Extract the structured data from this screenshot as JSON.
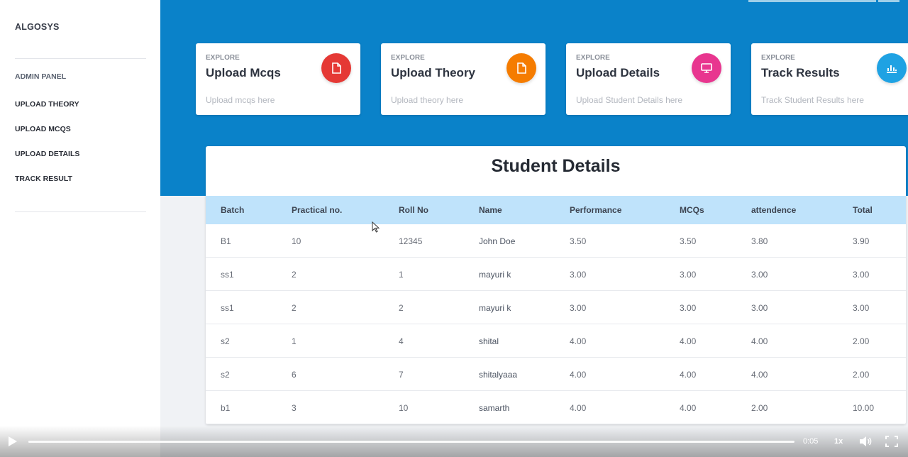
{
  "sidebar": {
    "brand": "ALGOSYS",
    "items": [
      {
        "label": "ADMIN PANEL"
      },
      {
        "label": "UPLOAD THEORY"
      },
      {
        "label": "UPLOAD MCQS"
      },
      {
        "label": "UPLOAD DETAILS"
      },
      {
        "label": "TRACK RESULT"
      }
    ]
  },
  "cards": [
    {
      "kicker": "EXPLORE",
      "title": "Upload Mcqs",
      "desc": "Upload mcqs here",
      "color": "#e53935",
      "icon": "document-icon"
    },
    {
      "kicker": "EXPLORE",
      "title": "Upload Theory",
      "desc": "Upload theory here",
      "color": "#f57c00",
      "icon": "document-icon"
    },
    {
      "kicker": "EXPLORE",
      "title": "Upload Details",
      "desc": "Upload Student Details here",
      "color": "#e8368f",
      "icon": "monitor-icon"
    },
    {
      "kicker": "EXPLORE",
      "title": "Track Results",
      "desc": "Track Student Results here",
      "color": "#1fa2e3",
      "icon": "chart-icon"
    }
  ],
  "table": {
    "title": "Student Details",
    "columns": [
      "Batch",
      "Practical no.",
      "Roll No",
      "Name",
      "Performance",
      "MCQs",
      "attendence",
      "Total"
    ],
    "rows": [
      [
        "B1",
        "10",
        "12345",
        "John Doe",
        "3.50",
        "3.50",
        "3.80",
        "3.90"
      ],
      [
        "ss1",
        "2",
        "1",
        "mayuri k",
        "3.00",
        "3.00",
        "3.00",
        "3.00"
      ],
      [
        "ss1",
        "2",
        "2",
        "mayuri k",
        "3.00",
        "3.00",
        "3.00",
        "3.00"
      ],
      [
        "s2",
        "1",
        "4",
        "shital",
        "4.00",
        "4.00",
        "4.00",
        "2.00"
      ],
      [
        "s2",
        "6",
        "7",
        "shitalyaaa",
        "4.00",
        "4.00",
        "4.00",
        "2.00"
      ],
      [
        "b1",
        "3",
        "10",
        "samarth",
        "4.00",
        "4.00",
        "2.00",
        "10.00"
      ]
    ]
  },
  "player": {
    "time": "0:05",
    "speed": "1x",
    "progress_pct": 0.5
  },
  "colors": {
    "header_blue": "#0a82c9",
    "table_header": "#bfe3fb"
  }
}
